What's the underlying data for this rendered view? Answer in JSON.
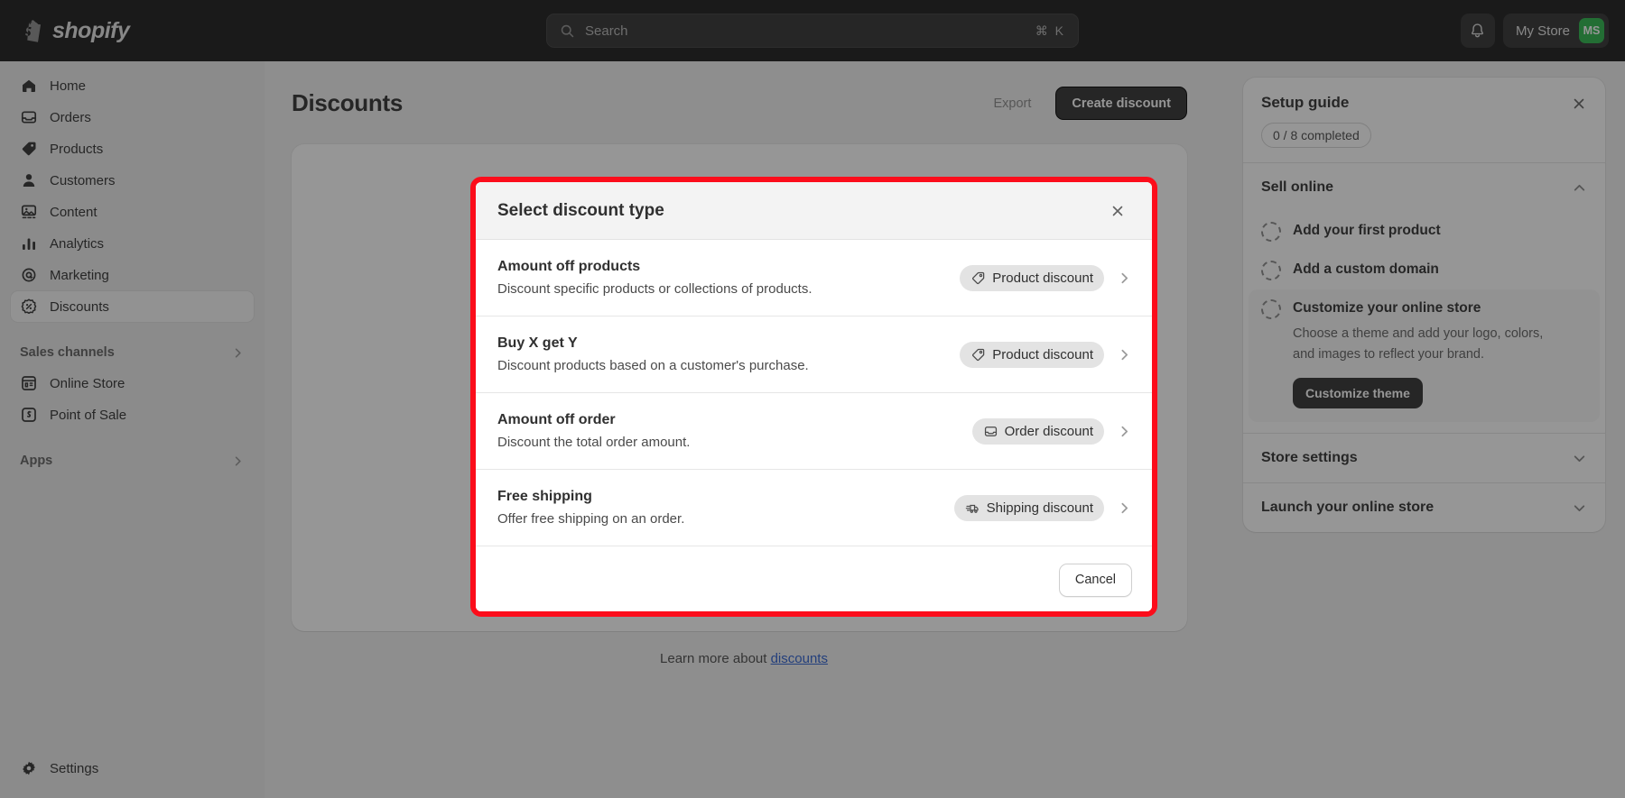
{
  "topbar": {
    "brand_name": "shopify",
    "brand_logo_icon": "shopify-bag-icon",
    "search": {
      "placeholder": "Search",
      "shortcut": "⌘ K",
      "icon": "search-icon"
    },
    "notifications_icon": "bell-icon",
    "store_name": "My Store",
    "avatar_initials": "MS",
    "avatar_color": "#2bb54a"
  },
  "sidebar": {
    "items": [
      {
        "label": "Home",
        "icon": "home-icon",
        "selected": false
      },
      {
        "label": "Orders",
        "icon": "orders-icon",
        "selected": false
      },
      {
        "label": "Products",
        "icon": "products-tag-icon",
        "selected": false
      },
      {
        "label": "Customers",
        "icon": "customers-person-icon",
        "selected": false
      },
      {
        "label": "Content",
        "icon": "content-image-icon",
        "selected": false
      },
      {
        "label": "Analytics",
        "icon": "analytics-bars-icon",
        "selected": false
      },
      {
        "label": "Marketing",
        "icon": "marketing-target-icon",
        "selected": false
      },
      {
        "label": "Discounts",
        "icon": "discounts-percent-icon",
        "selected": true
      }
    ],
    "sales_channels": {
      "label": "Sales channels",
      "chevron_icon": "chevron-right-icon",
      "items": [
        {
          "label": "Online Store",
          "icon": "online-store-icon"
        },
        {
          "label": "Point of Sale",
          "icon": "point-of-sale-icon"
        }
      ]
    },
    "apps": {
      "label": "Apps",
      "chevron_icon": "chevron-right-icon"
    },
    "settings": {
      "label": "Settings",
      "icon": "gear-icon"
    }
  },
  "main": {
    "page_title": "Discounts",
    "export_label": "Export",
    "create_label": "Create discount",
    "learn_more_prefix": "Learn more about ",
    "learn_more_link": "discounts"
  },
  "setup_guide": {
    "title": "Setup guide",
    "close_icon": "close-icon",
    "progress": "0 / 8 completed",
    "sections": [
      {
        "title": "Sell online",
        "expanded": true,
        "chevron_icon": "chevron-up-icon"
      },
      {
        "title": "Store settings",
        "expanded": false,
        "chevron_icon": "chevron-down-icon"
      },
      {
        "title": "Launch your online store",
        "expanded": false,
        "chevron_icon": "chevron-down-icon"
      }
    ],
    "tasks": [
      {
        "title": "Add your first product",
        "desc": "",
        "active": false,
        "button": ""
      },
      {
        "title": "Add a custom domain",
        "desc": "",
        "active": false,
        "button": ""
      },
      {
        "title": "Customize your online store",
        "desc": "Choose a theme and add your logo, colors, and images to reflect your brand.",
        "active": true,
        "button": "Customize theme"
      }
    ]
  },
  "modal": {
    "title": "Select discount type",
    "close_icon": "close-icon",
    "highlight_color": "#fc0d1b",
    "cancel_label": "Cancel",
    "options": [
      {
        "title": "Amount off products",
        "desc": "Discount specific products or collections of products.",
        "badge": "Product discount",
        "badge_icon": "tag-icon",
        "chevron_icon": "chevron-right-icon"
      },
      {
        "title": "Buy X get Y",
        "desc": "Discount products based on a customer's purchase.",
        "badge": "Product discount",
        "badge_icon": "tag-icon",
        "chevron_icon": "chevron-right-icon"
      },
      {
        "title": "Amount off order",
        "desc": "Discount the total order amount.",
        "badge": "Order discount",
        "badge_icon": "order-inbox-icon",
        "chevron_icon": "chevron-right-icon"
      },
      {
        "title": "Free shipping",
        "desc": "Offer free shipping on an order.",
        "badge": "Shipping discount",
        "badge_icon": "shipping-truck-icon",
        "chevron_icon": "chevron-right-icon"
      }
    ]
  }
}
